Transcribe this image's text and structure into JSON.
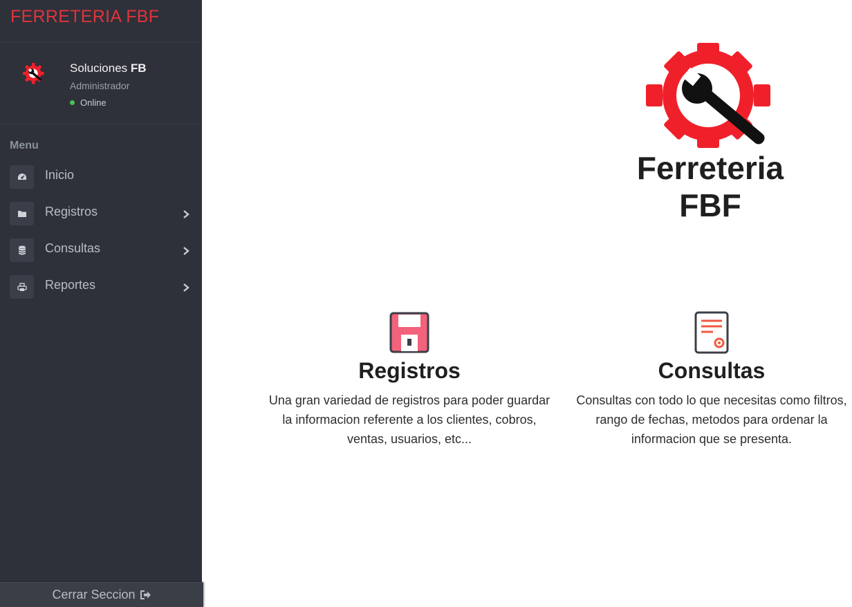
{
  "sidebar": {
    "brand": "FERRETERIA FBF",
    "user": {
      "name_prefix": "Soluciones ",
      "name_bold": "FB",
      "role": "Administrador",
      "status": "Online"
    },
    "menu_header": "Menu",
    "items": [
      {
        "label": "Inicio",
        "icon": "dashboard-icon",
        "has_submenu": false
      },
      {
        "label": "Registros",
        "icon": "folder-icon",
        "has_submenu": true
      },
      {
        "label": "Consultas",
        "icon": "database-icon",
        "has_submenu": true
      },
      {
        "label": "Reportes",
        "icon": "printer-icon",
        "has_submenu": true
      }
    ],
    "logout_label": "Cerrar Seccion"
  },
  "main": {
    "title": "Ferreteria FBF",
    "features": [
      {
        "title": "Registros",
        "icon": "floppy-disk-icon",
        "description": "Una gran variedad de registros para poder guardar la informacion referente a los clientes, cobros, ventas, usuarios, etc..."
      },
      {
        "title": "Consultas",
        "icon": "document-settings-icon",
        "description": "Consultas con todo lo que necesitas como filtros, rango de fechas, metodos para ordenar la informacion que se presenta."
      }
    ]
  },
  "colors": {
    "sidebar_bg": "#2e313a",
    "brand_red": "#e1333b",
    "logo_red": "#f0202a",
    "status_green": "#4cc04f"
  }
}
